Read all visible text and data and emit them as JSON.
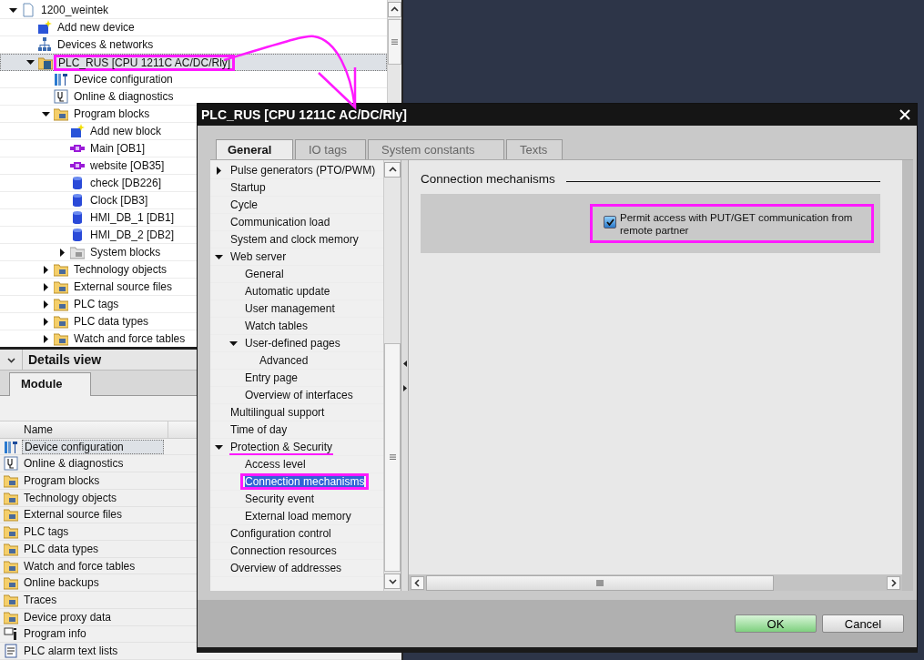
{
  "project_tree": {
    "items": [
      {
        "label": "1200_weintek",
        "kind": "project",
        "expanded": true,
        "selected": false,
        "children": [
          {
            "label": "Add new device",
            "kind": "add",
            "selected": false
          },
          {
            "label": "Devices & networks",
            "kind": "network",
            "selected": false
          },
          {
            "label": "PLC_RUS [CPU 1211C AC/DC/Rly]",
            "kind": "cpu",
            "expanded": true,
            "selected": true,
            "highlighted": true,
            "children": [
              {
                "label": "Device configuration",
                "kind": "config",
                "selected": false
              },
              {
                "label": "Online & diagnostics",
                "kind": "diagnostics",
                "selected": false
              },
              {
                "label": "Program blocks",
                "kind": "folder",
                "expanded": true,
                "selected": false,
                "children": [
                  {
                    "label": "Add new block",
                    "kind": "add",
                    "selected": false
                  },
                  {
                    "label": "Main [OB1]",
                    "kind": "ob",
                    "selected": false
                  },
                  {
                    "label": "website [OB35]",
                    "kind": "ob",
                    "selected": false
                  },
                  {
                    "label": "check [DB226]",
                    "kind": "db",
                    "selected": false
                  },
                  {
                    "label": "Clock [DB3]",
                    "kind": "db",
                    "selected": false
                  },
                  {
                    "label": "HMI_DB_1 [DB1]",
                    "kind": "db",
                    "selected": false
                  },
                  {
                    "label": "HMI_DB_2 [DB2]",
                    "kind": "db",
                    "selected": false
                  },
                  {
                    "label": "System blocks",
                    "kind": "graywfolder",
                    "expanded": false,
                    "selected": false
                  }
                ]
              },
              {
                "label": "Technology objects",
                "kind": "folder",
                "expanded": false,
                "selected": false
              },
              {
                "label": "External source files",
                "kind": "folder",
                "expanded": false,
                "selected": false
              },
              {
                "label": "PLC tags",
                "kind": "folder",
                "expanded": false,
                "selected": false
              },
              {
                "label": "PLC data types",
                "kind": "folder",
                "expanded": false,
                "selected": false
              },
              {
                "label": "Watch and force tables",
                "kind": "folder",
                "expanded": false,
                "selected": false
              }
            ]
          }
        ]
      }
    ]
  },
  "details_view": {
    "title": "Details view",
    "tabs": [
      {
        "label": "Module",
        "selected": true
      }
    ],
    "columns": [
      "Name"
    ],
    "rows": [
      {
        "label": "Device configuration",
        "kind": "config",
        "selected": true
      },
      {
        "label": "Online & diagnostics",
        "kind": "diagnostics",
        "selected": false
      },
      {
        "label": "Program blocks",
        "kind": "folder",
        "selected": false
      },
      {
        "label": "Technology objects",
        "kind": "folder",
        "selected": false
      },
      {
        "label": "External source files",
        "kind": "folder",
        "selected": false
      },
      {
        "label": "PLC tags",
        "kind": "folder",
        "selected": false
      },
      {
        "label": "PLC data types",
        "kind": "folder",
        "selected": false
      },
      {
        "label": "Watch and force tables",
        "kind": "folder",
        "selected": false
      },
      {
        "label": "Online backups",
        "kind": "folder",
        "selected": false
      },
      {
        "label": "Traces",
        "kind": "folder",
        "selected": false
      },
      {
        "label": "Device proxy data",
        "kind": "folder",
        "selected": false
      },
      {
        "label": "Program info",
        "kind": "info",
        "selected": false
      },
      {
        "label": "PLC alarm text lists",
        "kind": "list",
        "selected": false
      }
    ]
  },
  "dialog": {
    "title": "PLC_RUS [CPU 1211C AC/DC/Rly]",
    "tabs": [
      {
        "label": "General",
        "selected": true
      },
      {
        "label": "IO tags",
        "selected": false
      },
      {
        "label": "System constants",
        "selected": false
      },
      {
        "label": "Texts",
        "selected": false
      }
    ],
    "nav": [
      {
        "label": "Pulse generators (PTO/PWM)",
        "expanded": false,
        "selected": false
      },
      {
        "label": "Startup",
        "selected": false
      },
      {
        "label": "Cycle",
        "selected": false
      },
      {
        "label": "Communication load",
        "selected": false
      },
      {
        "label": "System and clock memory",
        "selected": false
      },
      {
        "label": "Web server",
        "expanded": true,
        "selected": false,
        "children": [
          {
            "label": "General",
            "selected": false
          },
          {
            "label": "Automatic update",
            "selected": false
          },
          {
            "label": "User management",
            "selected": false
          },
          {
            "label": "Watch tables",
            "selected": false
          },
          {
            "label": "User-defined pages",
            "expanded": true,
            "selected": false,
            "children": [
              {
                "label": "Advanced",
                "selected": false
              }
            ]
          },
          {
            "label": "Entry page",
            "selected": false
          },
          {
            "label": "Overview of interfaces",
            "selected": false
          }
        ]
      },
      {
        "label": "Multilingual support",
        "selected": false
      },
      {
        "label": "Time of day",
        "selected": false
      },
      {
        "label": "Protection & Security",
        "expanded": true,
        "selected": false,
        "underlined": true,
        "children": [
          {
            "label": "Access level",
            "selected": false
          },
          {
            "label": "Connection mechanisms",
            "selected": true,
            "highlighted": true
          },
          {
            "label": "Security event",
            "selected": false
          },
          {
            "label": "External load memory",
            "selected": false
          }
        ]
      },
      {
        "label": "Configuration control",
        "selected": false
      },
      {
        "label": "Connection resources",
        "selected": false
      },
      {
        "label": "Overview of addresses",
        "selected": false
      }
    ],
    "section": {
      "title": "Connection mechanisms",
      "options": [
        {
          "label": "Permit access with PUT/GET communication from remote partner",
          "checked": true,
          "highlighted": true
        }
      ]
    },
    "buttons": [
      {
        "label": "OK",
        "kind": "primary"
      },
      {
        "label": "Cancel",
        "kind": "secondary"
      }
    ]
  }
}
